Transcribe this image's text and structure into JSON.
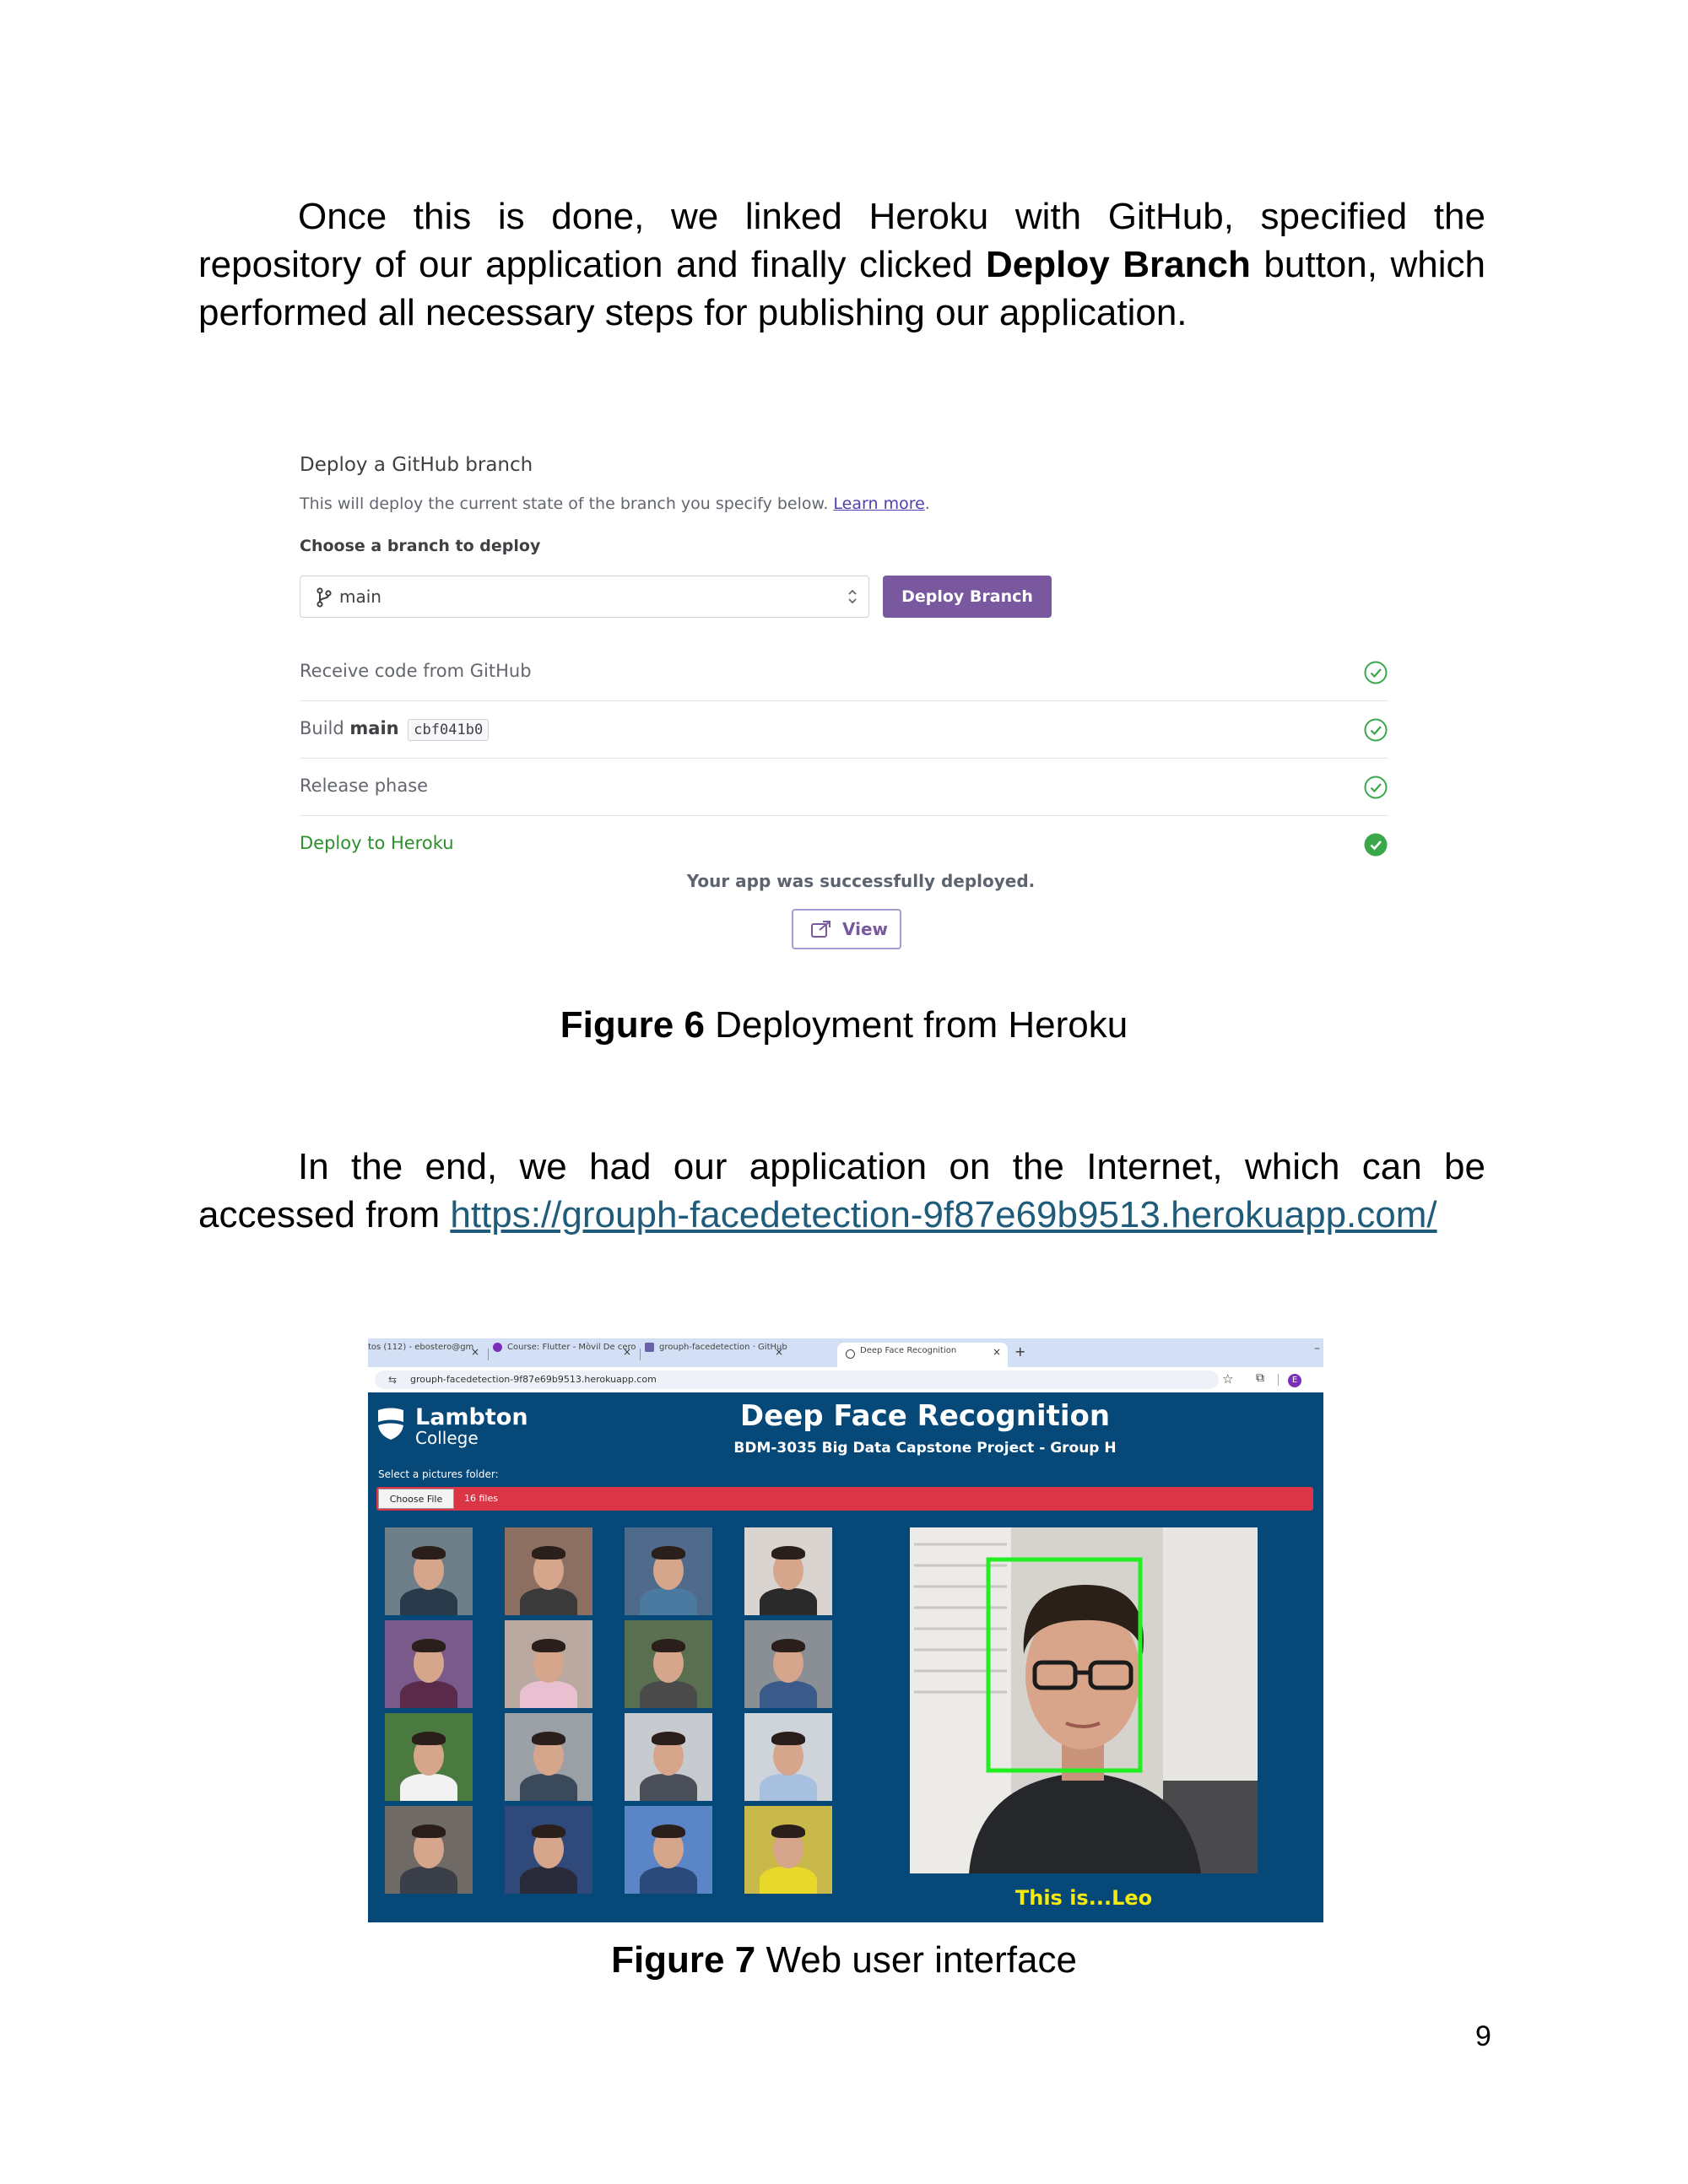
{
  "paragraph1": {
    "before_bold": "Once this is done, we linked Heroku with GitHub, specified the repository of our application and finally clicked ",
    "bold": "Deploy Branch",
    "after_bold": " button, which performed all necessary steps for publishing our application."
  },
  "heroku": {
    "title": "Deploy a GitHub branch",
    "description": "This will deploy the current state of the branch you specify below.",
    "learn_more": "Learn more",
    "period": ".",
    "choose_label": "Choose a branch to deploy",
    "branch_value": "main",
    "deploy_button": "Deploy Branch",
    "steps": [
      {
        "label": "Receive code from GitHub"
      },
      {
        "label_prefix": "Build",
        "branch": "main",
        "commit": "cbf041b0"
      },
      {
        "label": "Release phase"
      },
      {
        "label": "Deploy to Heroku"
      }
    ],
    "success": "Your app was successfully deployed.",
    "view_button": "View",
    "colors": {
      "accent": "#79589f",
      "success": "#2c8f2c"
    }
  },
  "figure6": {
    "label": "Figure 6",
    "text": "Deployment from Heroku"
  },
  "paragraph2": {
    "text": "In the end, we had our application on the Internet, which can be accessed from ",
    "link": "https://grouph-facedetection-9f87e69b9513.herokuapp.com/"
  },
  "browser": {
    "tabs": [
      {
        "label": "tos (112) - ebostero@gm",
        "icon": "mail-icon"
      },
      {
        "label": "Course: Flutter - Mòvil De cero",
        "icon": "course-icon"
      },
      {
        "label": "grouph-facedetection · GitHub",
        "icon": "heroku-icon"
      },
      {
        "label": "Deep Face Recognition",
        "icon": "globe-icon"
      }
    ],
    "new_tab": "+",
    "url": "grouph-facedetection-9f87e69b9513.herokuapp.com",
    "avatar_letter": "E",
    "app": {
      "logo_line1": "Lambton",
      "logo_line2": "College",
      "title": "Deep Face Recognition",
      "subtitle": "BDM-3035 Big Data Capstone Project - Group H",
      "select_label": "Select a pictures folder:",
      "choose_file": "Choose File",
      "file_count": "16 files",
      "result": "This is...Leo",
      "colors": {
        "background": "#064878",
        "file_bar": "#dc3545",
        "result_text": "#f5e90d",
        "face_box": "#22ee22"
      }
    }
  },
  "figure7": {
    "label": "Figure 7",
    "text": "Web user interface"
  },
  "page_number": "9"
}
